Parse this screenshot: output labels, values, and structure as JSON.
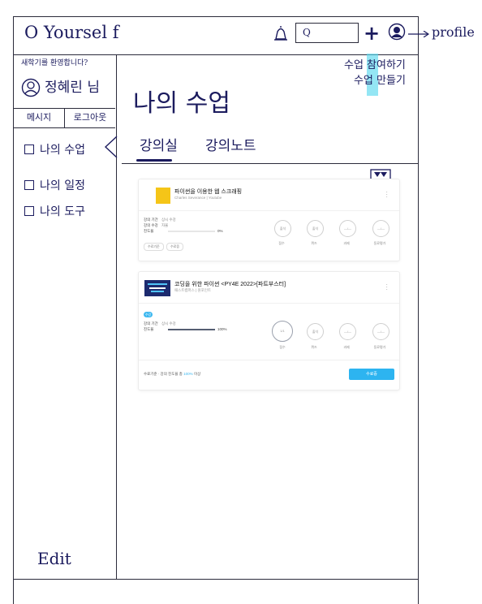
{
  "app": {
    "logo": "O Yoursel f"
  },
  "header": {
    "search_value": "Q",
    "plus_label": "+",
    "profile_note": "profile"
  },
  "notes": {
    "create_line1": "수업 참여하기",
    "create_line2": "수업 만들기"
  },
  "user": {
    "greeting": "새학기를 환영합니다?",
    "name": "정혜린 님"
  },
  "user_buttons": {
    "messages": "메시지",
    "logout": "로그아웃"
  },
  "sidebar": {
    "items": [
      {
        "label": "나의 수업"
      },
      {
        "label": "나의 일정"
      },
      {
        "label": "나의 도구"
      }
    ],
    "edit": "Edit"
  },
  "main": {
    "title": "나의 수업",
    "tabs": [
      {
        "label": "강의실"
      },
      {
        "label": "강의노트"
      }
    ]
  },
  "courses": [
    {
      "title": "파이썬을 이용한 웹 스크래핑",
      "subtitle": "Charles Severance | Youtube",
      "meta": [
        {
          "label": "강의 기간",
          "value": "상시 수강"
        },
        {
          "label": "강의 수강",
          "value": "자율"
        },
        {
          "label": "진도율",
          "value": ""
        }
      ],
      "progress_pct": 0,
      "progress_text": "0%",
      "chips": [
        "수료기준",
        "수료증"
      ],
      "circles": [
        {
          "value": "출석",
          "label": "점수",
          "big": false
        },
        {
          "value": "출석",
          "label": "퀴즈",
          "big": false
        },
        {
          "value": "—/—",
          "label": "과제",
          "big": false
        },
        {
          "value": "—/—",
          "label": "동료평가",
          "big": false
        }
      ]
    },
    {
      "title": "코딩을 위한 파이썬 <PY4E 2022>[파트부스터]",
      "subtitle": "패스트캠퍼스 | 원포인트",
      "badge": "수강",
      "meta": [
        {
          "label": "강의 기간",
          "value": "상시 수강"
        },
        {
          "label": "진도율",
          "value": ""
        }
      ],
      "progress_pct": 100,
      "progress_text": "100%",
      "circles": [
        {
          "value": "1/1",
          "label": "점수",
          "big": true
        },
        {
          "value": "출석",
          "label": "퀴즈",
          "big": false
        },
        {
          "value": "—/—",
          "label": "과제",
          "big": false
        },
        {
          "value": "—/—",
          "label": "동료평가",
          "big": false
        }
      ],
      "footer_prefix": "수료기준 · 강의 진도율 총",
      "footer_pct": "100%",
      "footer_suffix": "이상",
      "cta": "수료증"
    }
  ],
  "colors": {
    "ink": "#1b1b5e",
    "highlight": "#5bd8ee",
    "accent": "#2db4f0"
  }
}
